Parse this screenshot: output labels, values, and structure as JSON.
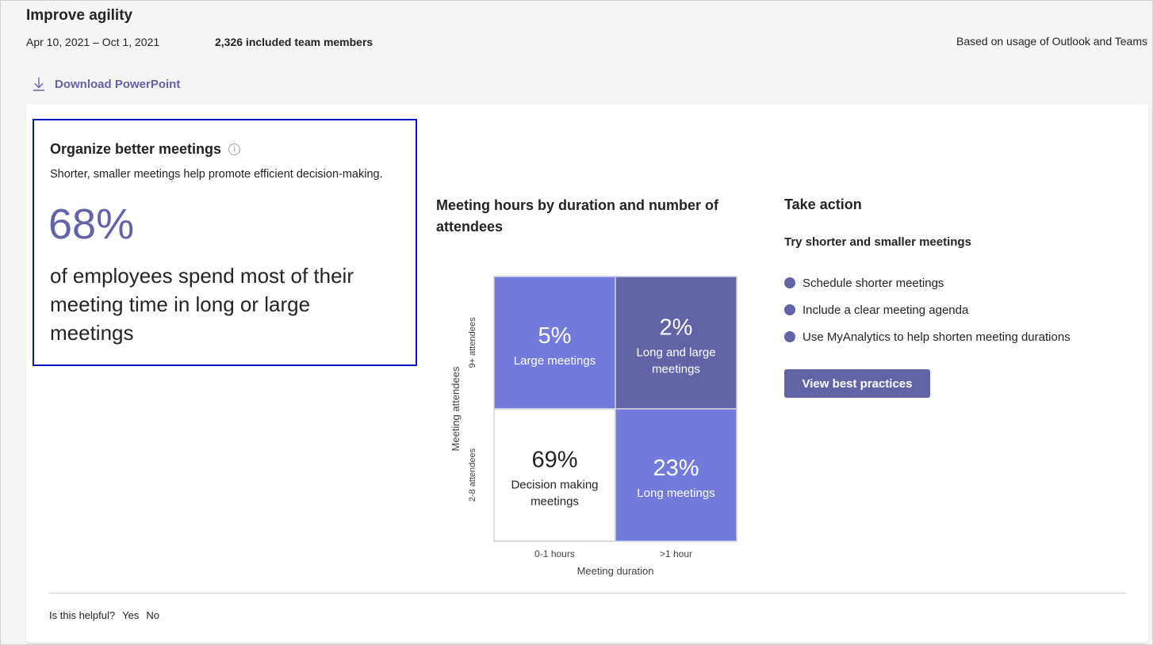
{
  "header": {
    "title": "Improve agility",
    "date_range": "Apr 10, 2021 – Oct 1, 2021",
    "members": "2,326 included team members",
    "source_note": "Based on usage of Outlook and Teams",
    "download_label": "Download PowerPoint"
  },
  "insight": {
    "title": "Organize better meetings",
    "description": "Shorter, smaller meetings help promote efficient decision-making.",
    "stat": "68%",
    "stat_text": "of employees spend most of their meeting time in long or large meetings"
  },
  "chart_title": "Meeting hours by duration and number of attendees",
  "chart_data": {
    "type": "heatmap",
    "x_categories": [
      "0-1 hours",
      ">1 hour"
    ],
    "y_categories": [
      "9+ attendees",
      "2-8 attendees"
    ],
    "xlabel": "Meeting duration",
    "ylabel": "Meeting attendees",
    "cells": [
      {
        "x": "0-1 hours",
        "y": "9+ attendees",
        "value": "5%",
        "label": "Large meetings",
        "color": "#7479dc"
      },
      {
        "x": ">1 hour",
        "y": "9+ attendees",
        "value": "2%",
        "label": "Long and large meetings",
        "color": "#6264a7"
      },
      {
        "x": "0-1 hours",
        "y": "2-8 attendees",
        "value": "69%",
        "label": "Decision making meetings",
        "color": "#ffffff"
      },
      {
        "x": ">1 hour",
        "y": "2-8 attendees",
        "value": "23%",
        "label": "Long meetings",
        "color": "#7479dc"
      }
    ]
  },
  "action": {
    "title": "Take action",
    "subtitle": "Try shorter and smaller meetings",
    "items": [
      "Schedule shorter meetings",
      "Include a clear meeting agenda",
      "Use MyAnalytics to help shorten meeting durations"
    ],
    "button_label": "View best practices"
  },
  "feedback": {
    "question": "Is this helpful?",
    "yes": "Yes",
    "no": "No"
  },
  "colors": {
    "accent": "#6264a7",
    "cell_light": "#7479dc",
    "selection_border": "#0a16c5"
  }
}
